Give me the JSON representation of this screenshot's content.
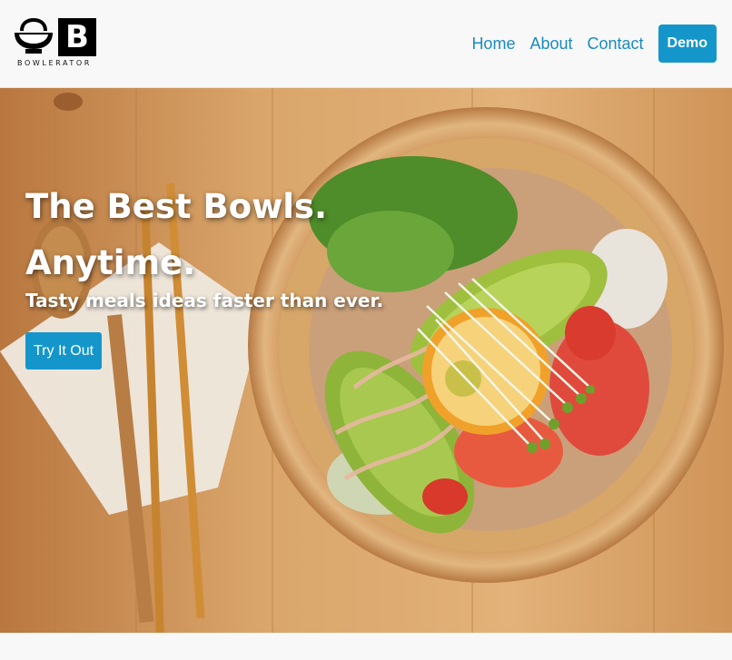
{
  "brand": {
    "wordmark": "BOWLERATOR",
    "letter": "B"
  },
  "nav": {
    "links": [
      "Home",
      "About",
      "Contact"
    ],
    "demo_label": "Demo"
  },
  "hero": {
    "title_line1": "The Best Bowls.",
    "title_line2": "Anytime.",
    "subtitle": "Tasty meals ideas faster than ever.",
    "cta_label": "Try It Out",
    "image": "bowl-photo"
  },
  "colors": {
    "accent": "#1596cb",
    "link": "#1a8bbf",
    "header_bg": "#f8f8f8"
  }
}
